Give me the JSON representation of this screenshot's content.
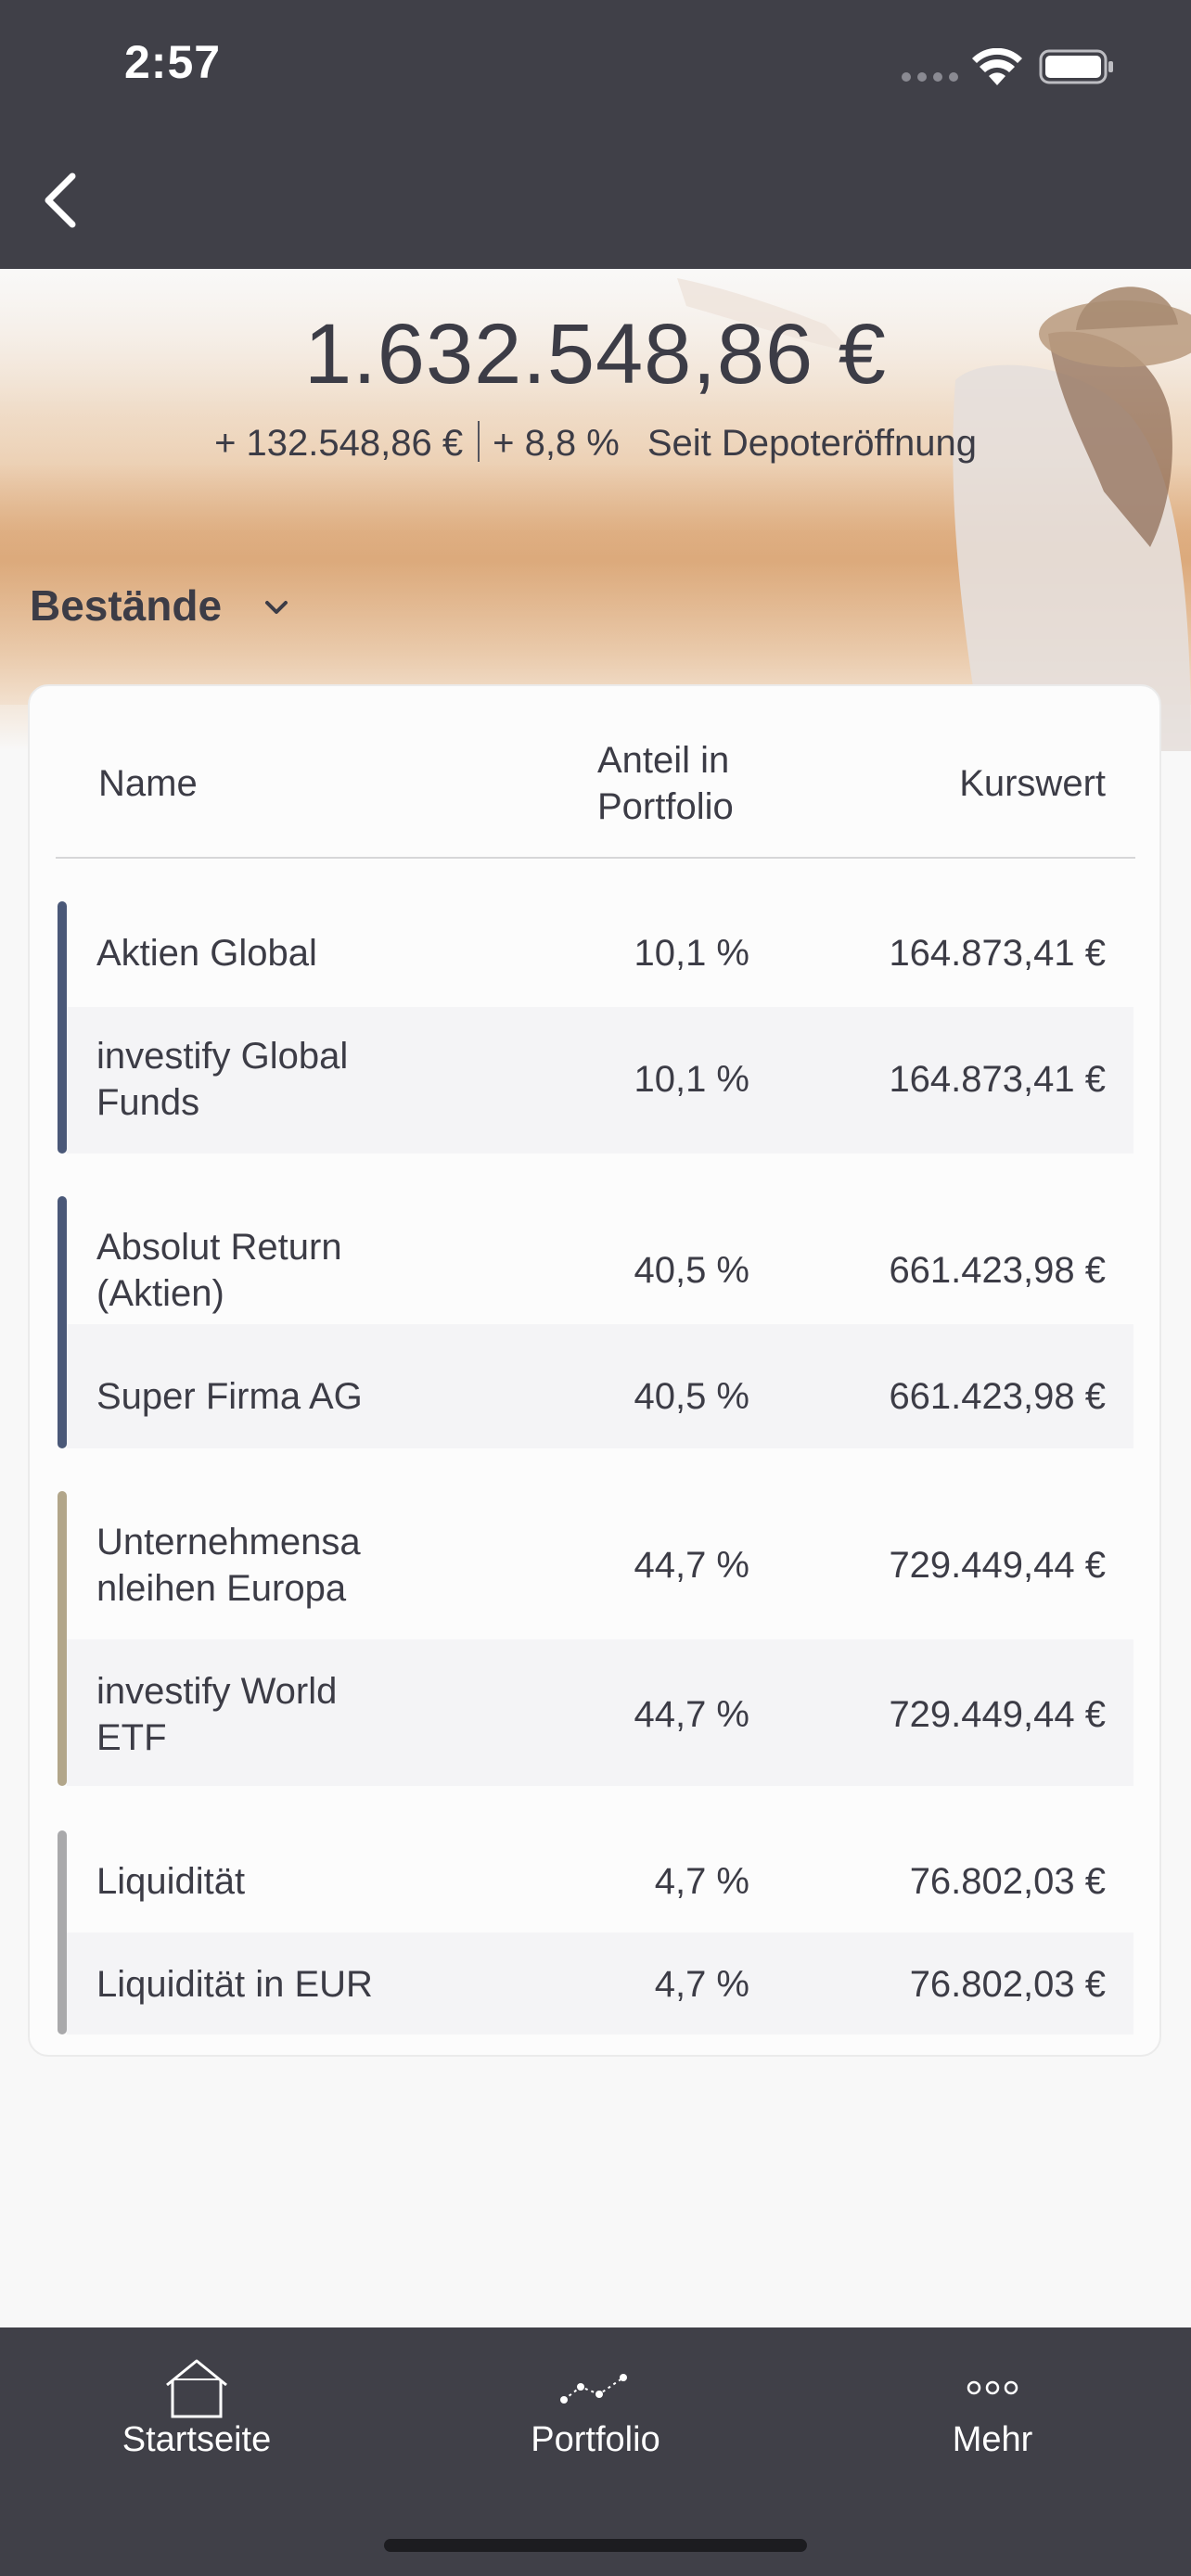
{
  "status_bar": {
    "time": "2:57"
  },
  "portfolio": {
    "total_value": "1.632.548,86 €",
    "change_absolute": "+ 132.548,86 €",
    "change_percent": "+ 8,8 %",
    "change_period": "Seit Depoteröffnung"
  },
  "section": {
    "title": "Bestände"
  },
  "table": {
    "headers": {
      "name": "Name",
      "share_line1": "Anteil in",
      "share_line2": "Portfolio",
      "value": "Kurswert"
    },
    "groups": [
      {
        "color": "#4a5878",
        "rows": [
          {
            "name_line1": "Aktien Global",
            "name_line2": "",
            "share": "10,1 %",
            "value": "164.873,41 €"
          },
          {
            "name_line1": "investify Global",
            "name_line2": "Funds",
            "share": "10,1 %",
            "value": "164.873,41 €"
          }
        ]
      },
      {
        "color": "#4a5878",
        "rows": [
          {
            "name_line1": "Absolut Return",
            "name_line2": "(Aktien)",
            "share": "40,5 %",
            "value": "661.423,98 €"
          },
          {
            "name_line1": "Super Firma AG",
            "name_line2": "",
            "share": "40,5 %",
            "value": "661.423,98 €"
          }
        ]
      },
      {
        "color": "#b2a68a",
        "rows": [
          {
            "name_line1": "Unternehmensa",
            "name_line2": "nleihen Europa",
            "share": "44,7 %",
            "value": "729.449,44 €"
          },
          {
            "name_line1": "investify World",
            "name_line2": "ETF",
            "share": "44,7 %",
            "value": "729.449,44 €"
          }
        ]
      },
      {
        "color": "#a9a9ab",
        "rows": [
          {
            "name_line1": "Liquidität",
            "name_line2": "",
            "share": "4,7 %",
            "value": "76.802,03 €"
          },
          {
            "name_line1": "Liquidität in EUR",
            "name_line2": "",
            "share": "4,7 %",
            "value": "76.802,03 €"
          }
        ]
      }
    ]
  },
  "tab_bar": {
    "items": [
      {
        "label": "Startseite",
        "icon": "home-icon"
      },
      {
        "label": "Portfolio",
        "icon": "portfolio-chart-icon"
      },
      {
        "label": "Mehr",
        "icon": "more-dots-icon"
      }
    ]
  }
}
